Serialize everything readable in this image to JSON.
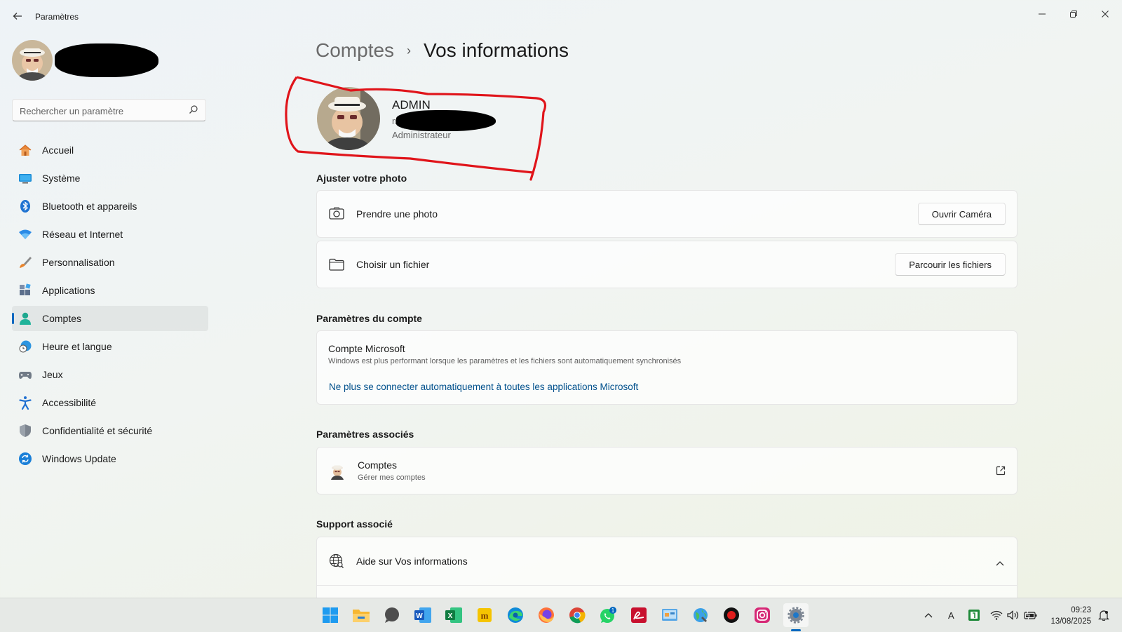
{
  "window": {
    "title": "Paramètres",
    "back_icon": "arrow-left-icon",
    "controls": [
      "minimize-icon",
      "restore-icon",
      "close-icon"
    ]
  },
  "sidebar": {
    "search_placeholder": "Rechercher un paramètre",
    "items": [
      {
        "label": "Accueil",
        "icon": "home-icon"
      },
      {
        "label": "Système",
        "icon": "system-icon"
      },
      {
        "label": "Bluetooth et appareils",
        "icon": "bluetooth-icon"
      },
      {
        "label": "Réseau et Internet",
        "icon": "wifi-icon"
      },
      {
        "label": "Personnalisation",
        "icon": "brush-icon"
      },
      {
        "label": "Applications",
        "icon": "apps-icon"
      },
      {
        "label": "Comptes",
        "icon": "account-icon",
        "active": true
      },
      {
        "label": "Heure et langue",
        "icon": "clock-globe-icon"
      },
      {
        "label": "Jeux",
        "icon": "gamepad-icon"
      },
      {
        "label": "Accessibilité",
        "icon": "accessibility-icon"
      },
      {
        "label": "Confidentialité et sécurité",
        "icon": "shield-icon"
      },
      {
        "label": "Windows Update",
        "icon": "update-icon"
      }
    ]
  },
  "header": {
    "breadcrumb_parent": "Comptes",
    "breadcrumb_separator": "›",
    "breadcrumb_current": "Vos informations"
  },
  "profile": {
    "name": "ADMIN",
    "email_visible": "m",
    "role": "Administrateur"
  },
  "photo_section": {
    "title": "Ajuster votre photo",
    "rows": [
      {
        "label": "Prendre une photo",
        "button": "Ouvrir Caméra",
        "icon": "camera-icon"
      },
      {
        "label": "Choisir un fichier",
        "button": "Parcourir les fichiers",
        "icon": "folder-icon"
      }
    ]
  },
  "account_section": {
    "title": "Paramètres du compte",
    "card_title": "Compte Microsoft",
    "card_desc": "Windows est plus performant lorsque les paramètres et les fichiers sont automatiquement synchronisés",
    "link": "Ne plus se connecter automatiquement à toutes les applications Microsoft"
  },
  "related_section": {
    "title": "Paramètres associés",
    "item_title": "Comptes",
    "item_sub": "Gérer mes comptes",
    "item_icon": "external-link-icon"
  },
  "support_section": {
    "title": "Support associé",
    "item_label": "Aide sur Vos informations",
    "item_icon": "globe-help-icon",
    "chevron": "chevron-up-icon"
  },
  "taskbar": {
    "apps": [
      "start-icon",
      "file-explorer-icon",
      "chat-bubble-icon",
      "word-icon",
      "excel-icon",
      "app-m-icon",
      "edge-icon",
      "firefox-icon",
      "chrome-icon",
      "whatsapp-icon",
      "pdf-app-icon",
      "control-panel-icon",
      "globe-app-icon",
      "record-icon",
      "instagram-icon",
      "settings-icon"
    ],
    "whatsapp_badge": "1",
    "tray_ime": "A",
    "time": "09:23",
    "date": "13/08/2025"
  },
  "colors": {
    "accent": "#0067c0",
    "link": "#00508c",
    "annotation_red": "#e0141a"
  }
}
